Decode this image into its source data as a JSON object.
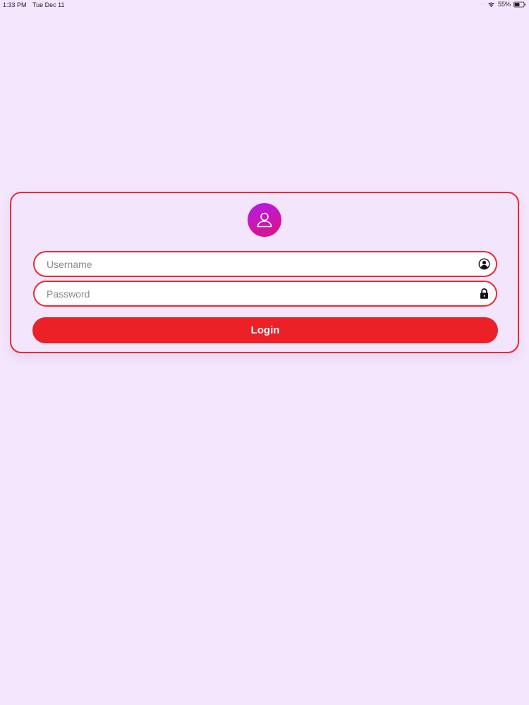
{
  "status_bar": {
    "time": "1:33 PM",
    "date": "Tue Dec 11",
    "battery": "55%",
    "icons": [
      "signal-dots-icon",
      "wifi-icon",
      "battery-icon"
    ]
  },
  "login": {
    "avatar_icon": "user-icon",
    "username_placeholder": "Username",
    "username_value": "",
    "username_icon": "user-circle-icon",
    "password_placeholder": "Password",
    "password_value": "",
    "password_icon": "lock-icon",
    "button_label": "Login"
  },
  "colors": {
    "background": "#f4e6fd",
    "accent": "#ec2127",
    "border": "#ec2a31",
    "avatar_gradient_start": "#b31bf0",
    "avatar_gradient_end": "#e0127a"
  }
}
